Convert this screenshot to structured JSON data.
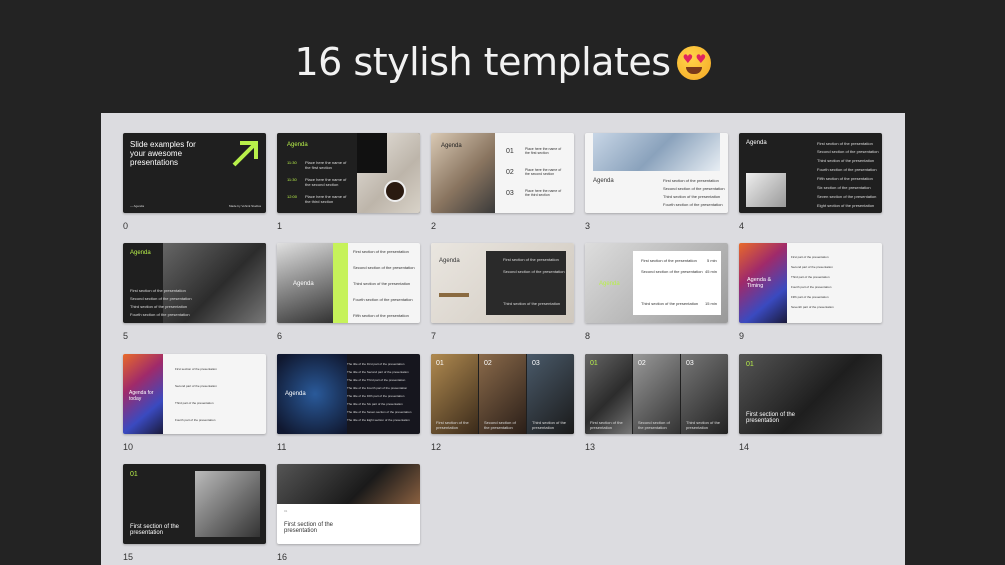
{
  "page_title": "16 stylish templates",
  "emoji_icon": "heart-eyes-emoji",
  "accent_color": "#b8f04a",
  "slides": [
    {
      "index": "0",
      "heading": "Slide examples for your awesome presentations",
      "footer_left": "— Agenda",
      "footer_right": "Made by Vohnik Studios"
    },
    {
      "index": "1",
      "heading": "Agenda",
      "items": [
        {
          "time": "11:30",
          "text": "Place here the name of the first section"
        },
        {
          "time": "11:30",
          "text": "Place here the name of the second section"
        },
        {
          "time": "12:00",
          "text": "Place here the name of the third section"
        }
      ]
    },
    {
      "index": "2",
      "heading": "Agenda",
      "items": [
        {
          "num": "01",
          "text": "Place here the name of the first section"
        },
        {
          "num": "02",
          "text": "Place here the name of the second section"
        },
        {
          "num": "03",
          "text": "Place here the name of the third section"
        }
      ]
    },
    {
      "index": "3",
      "heading": "Agenda",
      "items": [
        "First section of the presentation",
        "Second section of the presentation",
        "Third section of the presentation",
        "Fourth section of the presentation"
      ]
    },
    {
      "index": "4",
      "heading": "Agenda",
      "items": [
        "First section of the presentation",
        "Second section of the presentation",
        "Third section of the presentation",
        "Fourth section of the presentation",
        "Fifth section of the presentation",
        "Six section of the presentation",
        "Seven section of the presentation",
        "Eight section of the presentation"
      ]
    },
    {
      "index": "5",
      "heading": "Agenda",
      "items": [
        "First section of the presentation",
        "Second section of the presentation",
        "Third section of the presentation",
        "Fourth section of the presentation"
      ]
    },
    {
      "index": "6",
      "heading": "Agenda",
      "items": [
        "First section of the presentation",
        "Second section of the presentation",
        "Third section of the presentation",
        "Fourth section of the presentation",
        "Fifth section of the presentation"
      ]
    },
    {
      "index": "7",
      "heading": "Agenda",
      "items": [
        "First section of the presentation",
        "Second section of the presentation",
        "Third section of the presentation"
      ]
    },
    {
      "index": "8",
      "heading": "Agenda",
      "items": [
        {
          "text": "First section of the presentation",
          "duration": "5 min"
        },
        {
          "text": "Second section of the presentation",
          "duration": "45 min"
        },
        {
          "text": "Third section of the presentation",
          "duration": "15 min"
        }
      ]
    },
    {
      "index": "9",
      "heading": "Agenda & Timing",
      "rows": [
        "First part of the presentation",
        "Second part of the presentation",
        "Third part of the presentation",
        "Fourth part of the presentation",
        "Fifth part of the presentation",
        "Seventh part of the presentation"
      ]
    },
    {
      "index": "10",
      "heading": "Agenda for today",
      "rows": [
        "First section of the presentation",
        "Second part of the presentation",
        "Third part of the presentation",
        "Fourth part of the presentation"
      ]
    },
    {
      "index": "11",
      "heading": "Agenda",
      "rows": [
        "The title of the First part of the presentation",
        "The title of the Second part of the presentation",
        "The title of the Third part of the presentation",
        "The title of the Fourth part of the presentation",
        "The title of the Fifth part of the presentation",
        "The title of the Six part of the presentation",
        "The title of the Seven section of the presentation",
        "The title of the Eight section of the presentation"
      ]
    },
    {
      "index": "12",
      "panels": [
        {
          "num": "01",
          "text": "First section of the presentation"
        },
        {
          "num": "02",
          "text": "Second section of the presentation"
        },
        {
          "num": "03",
          "text": "Third section of the presentation"
        }
      ]
    },
    {
      "index": "13",
      "panels": [
        {
          "num": "01",
          "text": "First section of the presentation"
        },
        {
          "num": "02",
          "text": "Second section of the presentation"
        },
        {
          "num": "03",
          "text": "Third section of the presentation"
        }
      ]
    },
    {
      "index": "14",
      "num": "01",
      "text": "First section of the presentation"
    },
    {
      "index": "15",
      "num": "01",
      "text": "First section of the presentation"
    },
    {
      "index": "16",
      "num": "01",
      "text": "First section of the presentation"
    }
  ]
}
